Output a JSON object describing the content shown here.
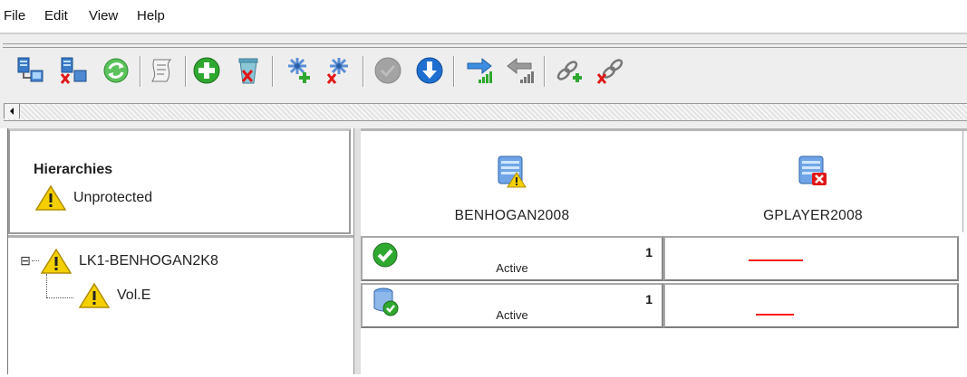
{
  "menu": {
    "items": [
      "File",
      "Edit",
      "View",
      "Help"
    ]
  },
  "toolbar": {
    "buttons": [
      "connect-server-icon",
      "disconnect-server-icon",
      "refresh-icon",
      "view-log-icon",
      "create-resource-icon",
      "delete-resource-icon",
      "extend-resource-icon",
      "unextend-resource-icon",
      "in-service-icon",
      "out-of-service-icon",
      "create-dependency-icon",
      "delete-dependency-icon",
      "add-comm-path-icon",
      "remove-comm-path-icon"
    ]
  },
  "left": {
    "hierarchies_title": "Hierarchies",
    "hierarchies_status": "Unprotected",
    "tree": [
      {
        "label": "LK1-BENHOGAN2K8",
        "level": 0,
        "expander": "⊟"
      },
      {
        "label": "Vol.E",
        "level": 1
      }
    ]
  },
  "servers": [
    {
      "name": "BENHOGAN2008",
      "status_icon": "server-warning-icon"
    },
    {
      "name": "GPLAYER2008",
      "status_icon": "server-error-icon"
    }
  ],
  "rows": [
    {
      "icon": "green-check-icon",
      "state": "Active",
      "priority": "1"
    },
    {
      "icon": "volume-active-icon",
      "state": "Active",
      "priority": "1"
    }
  ],
  "colors": {
    "accent_blue": "#1f6fd1",
    "warning_yellow": "#f5d000",
    "error_red": "#ff1a1a",
    "ok_green": "#2fa82f"
  }
}
